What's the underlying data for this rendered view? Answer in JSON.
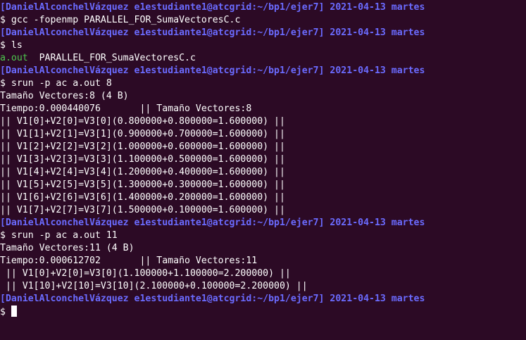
{
  "colors": {
    "background": "#2c0a25",
    "prompt": "#6b6bff",
    "text": "#ffffff",
    "executable": "#4ec94e"
  },
  "terminal": {
    "lines": [
      {
        "kind": "prompt",
        "text": "[DanielAlconchelVázquez e1estudiante1@atcgrid:~/bp1/ejer7] 2021-04-13 martes"
      },
      {
        "kind": "command",
        "text": "gcc -fopenmp PARALLEL_FOR_SumaVectoresC.c"
      },
      {
        "kind": "prompt",
        "text": "[DanielAlconchelVázquez e1estudiante1@atcgrid:~/bp1/ejer7] 2021-04-13 martes"
      },
      {
        "kind": "command",
        "text": "ls"
      },
      {
        "kind": "ls",
        "exec": "a.out",
        "rest": "  PARALLEL_FOR_SumaVectoresC.c"
      },
      {
        "kind": "prompt",
        "text": "[DanielAlconchelVázquez e1estudiante1@atcgrid:~/bp1/ejer7] 2021-04-13 martes"
      },
      {
        "kind": "command",
        "text": "srun -p ac a.out 8"
      },
      {
        "kind": "output",
        "text": "Tamaño Vectores:8 (4 B)"
      },
      {
        "kind": "output",
        "text": "Tiempo:0.000440076       || Tamaño Vectores:8"
      },
      {
        "kind": "output",
        "text": "|| V1[0]+V2[0]=V3[0](0.800000+0.800000=1.600000) ||"
      },
      {
        "kind": "output",
        "text": "|| V1[1]+V2[1]=V3[1](0.900000+0.700000=1.600000) ||"
      },
      {
        "kind": "output",
        "text": "|| V1[2]+V2[2]=V3[2](1.000000+0.600000=1.600000) ||"
      },
      {
        "kind": "output",
        "text": "|| V1[3]+V2[3]=V3[3](1.100000+0.500000=1.600000) ||"
      },
      {
        "kind": "output",
        "text": "|| V1[4]+V2[4]=V3[4](1.200000+0.400000=1.600000) ||"
      },
      {
        "kind": "output",
        "text": "|| V1[5]+V2[5]=V3[5](1.300000+0.300000=1.600000) ||"
      },
      {
        "kind": "output",
        "text": "|| V1[6]+V2[6]=V3[6](1.400000+0.200000=1.600000) ||"
      },
      {
        "kind": "output",
        "text": "|| V1[7]+V2[7]=V3[7](1.500000+0.100000=1.600000) ||"
      },
      {
        "kind": "prompt",
        "text": "[DanielAlconchelVázquez e1estudiante1@atcgrid:~/bp1/ejer7] 2021-04-13 martes"
      },
      {
        "kind": "command",
        "text": "srun -p ac a.out 11"
      },
      {
        "kind": "output",
        "text": "Tamaño Vectores:11 (4 B)"
      },
      {
        "kind": "output",
        "text": "Tiempo:0.000612702       || Tamaño Vectores:11"
      },
      {
        "kind": "output",
        "text": " || V1[0]+V2[0]=V3[0](1.100000+1.100000=2.200000) ||"
      },
      {
        "kind": "output",
        "text": " || V1[10]+V2[10]=V3[10](2.100000+0.100000=2.200000) ||"
      },
      {
        "kind": "prompt",
        "text": "[DanielAlconchelVázquez e1estudiante1@atcgrid:~/bp1/ejer7] 2021-04-13 martes"
      },
      {
        "kind": "input",
        "text": ""
      }
    ]
  }
}
